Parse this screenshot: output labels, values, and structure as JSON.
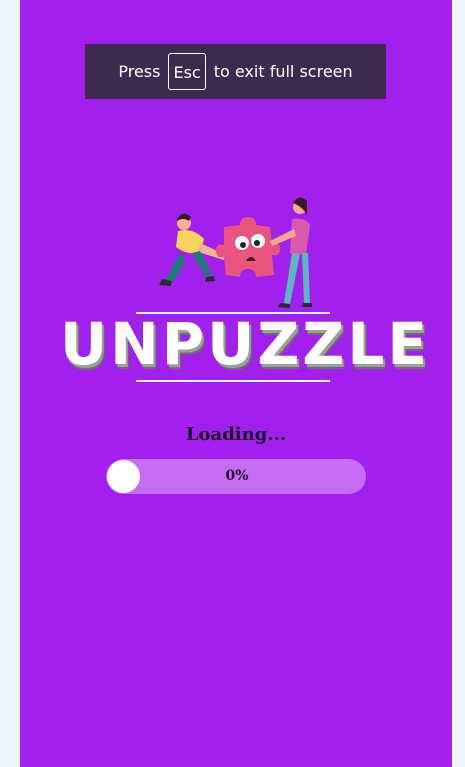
{
  "fullscreen_notice": {
    "press": "Press",
    "key": "Esc",
    "suffix": "to exit full screen"
  },
  "logo": {
    "title": "UNPUZZLE"
  },
  "loader": {
    "label": "Loading...",
    "percent_text": "0%",
    "progress": 0
  },
  "colors": {
    "background": "#a120ee",
    "banner": "#3e2a4e",
    "bar_track": "#c66df6",
    "puzzle_piece": "#e9557e"
  }
}
